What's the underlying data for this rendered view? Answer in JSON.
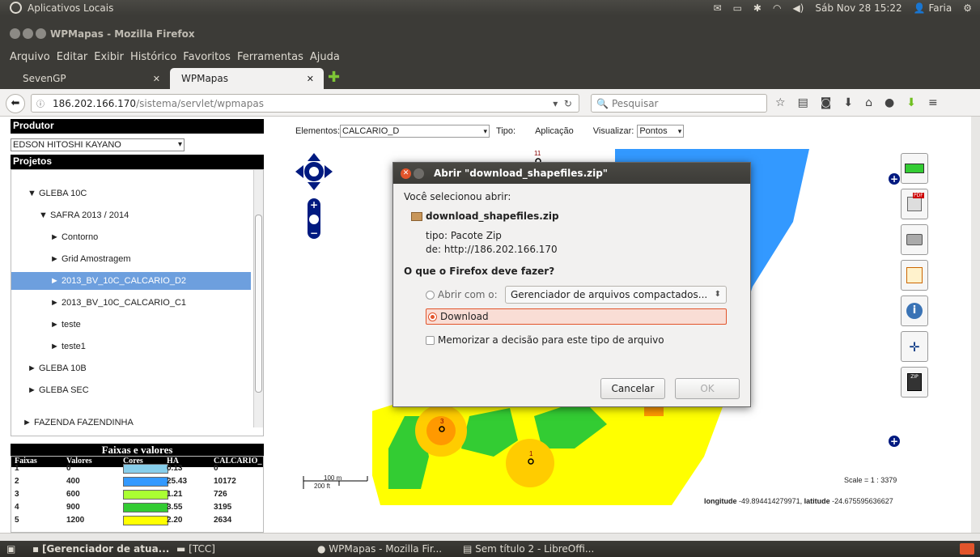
{
  "desktop": {
    "panel_title": "Aplicativos Locais",
    "clock": "Sáb Nov 28 15:22",
    "user": "Faria"
  },
  "window": {
    "title": "WPMapas - Mozilla Firefox"
  },
  "menu": [
    "Arquivo",
    "Editar",
    "Exibir",
    "Histórico",
    "Favoritos",
    "Ferramentas",
    "Ajuda"
  ],
  "tabs": [
    {
      "label": "SevenGP"
    },
    {
      "label": "WPMapas"
    }
  ],
  "nav": {
    "url_host": "186.202.166.170",
    "url_path": "/sistema/servlet/wpmapas",
    "search_placeholder": "Pesquisar"
  },
  "left": {
    "produtor_header": "Produtor",
    "produtor_value": "EDSON HITOSHI KAYANO",
    "projetos_header": "Projetos",
    "tree": [
      {
        "label": "GLEBA 10C",
        "arrow": "▼"
      },
      {
        "label": "SAFRA 2013 / 2014",
        "arrow": "▼"
      },
      {
        "label": "Contorno",
        "arrow": "►"
      },
      {
        "label": "Grid Amostragem",
        "arrow": "►"
      },
      {
        "label": "2013_BV_10C_CALCARIO_D2",
        "arrow": "►"
      },
      {
        "label": "2013_BV_10C_CALCARIO_C1",
        "arrow": "►"
      },
      {
        "label": "teste",
        "arrow": "►"
      },
      {
        "label": "teste1",
        "arrow": "►"
      },
      {
        "label": "GLEBA 10B",
        "arrow": "►"
      },
      {
        "label": "GLEBA SEC",
        "arrow": "►"
      },
      {
        "label": "FAZENDA FAZENDINHA",
        "arrow": "►"
      }
    ],
    "faixas_title": "Faixas e valores",
    "faixas_headers": [
      "Faixas",
      "Valores",
      "Cores",
      "HA",
      "CALCARIO_"
    ],
    "faixas_rows": [
      {
        "faixa": "1",
        "valor": "0",
        "cor": "#87ceeb",
        "ha": "0.13",
        "calc": "0"
      },
      {
        "faixa": "2",
        "valor": "400",
        "cor": "#3399ff",
        "ha": "25.43",
        "calc": "10172"
      },
      {
        "faixa": "3",
        "valor": "600",
        "cor": "#aaff33",
        "ha": "1.21",
        "calc": "726"
      },
      {
        "faixa": "4",
        "valor": "900",
        "cor": "#33cc33",
        "ha": "3.55",
        "calc": "3195"
      },
      {
        "faixa": "5",
        "valor": "1200",
        "cor": "#ffff00",
        "ha": "2.20",
        "calc": "2634"
      }
    ]
  },
  "map": {
    "elementos_label": "Elementos:",
    "elementos_value": "CALCARIO_D",
    "tipo_label": "Tipo:",
    "tipo_value": "Aplicação",
    "visualizar_label": "Visualizar:",
    "visualizar_value": "Pontos",
    "scale_m": "100 m",
    "scale_ft": "200 ft",
    "scale_text": "Scale = 1 : 3379",
    "coord_lon_label": "longitude",
    "coord_lon": "-49.894414279971,",
    "coord_lat_label": "latitude",
    "coord_lat": "-24.675595636627",
    "point_labels": [
      "11",
      "3",
      "1"
    ]
  },
  "dialog": {
    "title": "Abrir \"download_shapefiles.zip\"",
    "selecionou": "Você selecionou abrir:",
    "filename": "download_shapefiles.zip",
    "tipo": "tipo: Pacote Zip",
    "de": "de: http://186.202.166.170",
    "question": "O que o Firefox deve fazer?",
    "abrir_com": "Abrir com o:",
    "abrir_app": "Gerenciador de arquivos compactados...",
    "download": "Download",
    "memorizar": "Memorizar a decisão para este tipo de arquivo",
    "cancel": "Cancelar",
    "ok": "OK"
  },
  "taskbar": [
    {
      "label": "[Gerenciador de atua..."
    },
    {
      "label": "[TCC]"
    },
    {
      "label": "WPMapas - Mozilla Fir..."
    },
    {
      "label": "Sem título 2 - LibreOffi..."
    }
  ]
}
